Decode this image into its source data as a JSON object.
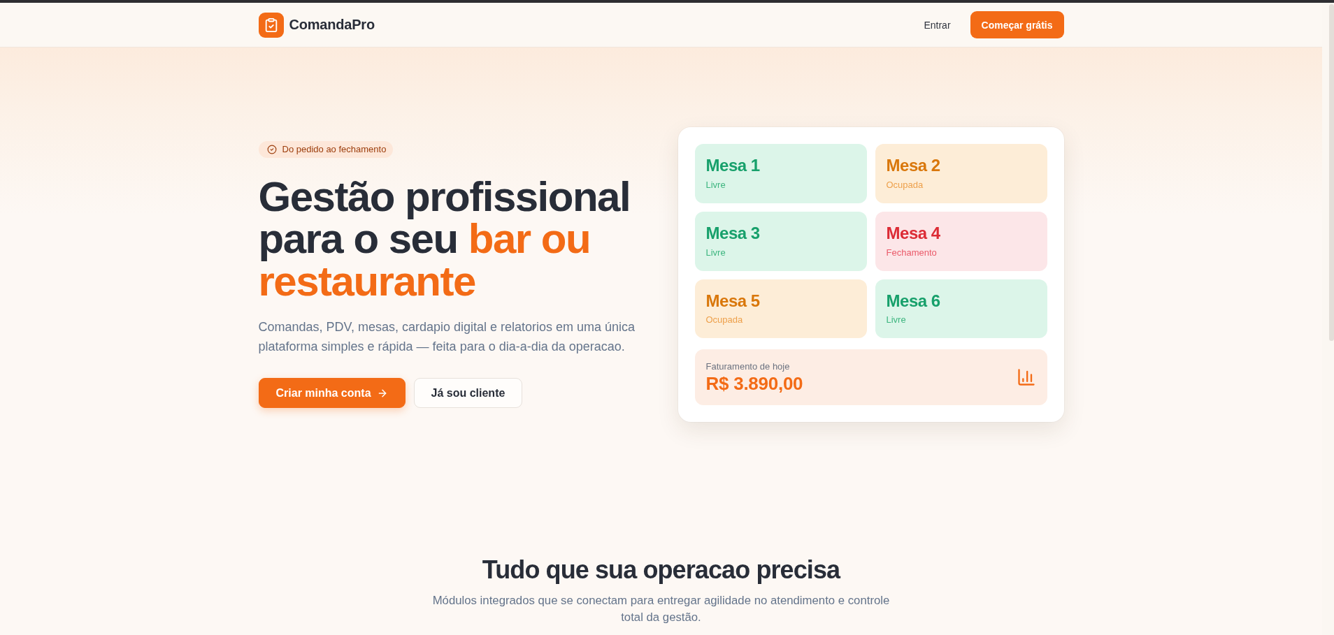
{
  "header": {
    "brand": "ComandaPro",
    "login": "Entrar",
    "cta": "Começar grátis"
  },
  "hero": {
    "tagline": "Do pedido ao fechamento",
    "title": "Gestão profissional para o seu",
    "title_highlight": "bar ou restaurante",
    "description": "Comandas, PDV, mesas, cardapio digital e relatorios em uma única plataforma simples e rápida — feita para o dia-a-dia da operacao.",
    "buttons": [
      {
        "label": "Criar minha conta",
        "kind": "primary"
      },
      {
        "label": "Já sou cliente",
        "kind": "secondary"
      }
    ]
  },
  "tables_preview": {
    "tables": [
      {
        "name": "Mesa 1",
        "status": "Livre",
        "kind": "free"
      },
      {
        "name": "Mesa 2",
        "status": "Ocupada",
        "kind": "occupied"
      },
      {
        "name": "Mesa 3",
        "status": "Livre",
        "kind": "free"
      },
      {
        "name": "Mesa 4",
        "status": "Fechamento",
        "kind": "closing"
      },
      {
        "name": "Mesa 5",
        "status": "Ocupada",
        "kind": "occupied"
      },
      {
        "name": "Mesa 6",
        "status": "Livre",
        "kind": "free"
      }
    ],
    "revenue": {
      "label": "Faturamento de hoje",
      "value": "R$ 3.890,00"
    }
  },
  "features": {
    "title": "Tudo que sua operacao precisa",
    "subtitle": "Módulos integrados que se conectam para entregar agilidade no atendimento e controle total da gestão."
  }
}
